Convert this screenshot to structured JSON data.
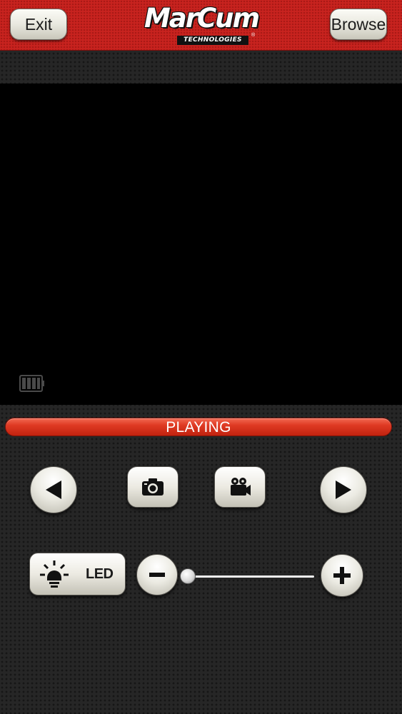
{
  "header": {
    "exit_label": "Exit",
    "browse_label": "Browse",
    "logo_text": "MarCum",
    "logo_subtext": "TECHNOLOGIES"
  },
  "status": {
    "text": "PLAYING"
  },
  "controls": {
    "prev_icon": "triangle-left-icon",
    "camera_icon": "camera-icon",
    "record_icon": "video-camera-icon",
    "next_icon": "triangle-right-icon",
    "led_label": "LED",
    "led_icon": "light-bulb-icon",
    "minus_icon": "minus-icon",
    "plus_icon": "plus-icon",
    "led_brightness_fraction": 0.0
  },
  "video": {
    "battery_icon": "battery-icon"
  },
  "colors": {
    "header_red": "#c8231f",
    "status_red": "#df3a23",
    "button_face": "#ecebe3",
    "background": "#262626"
  }
}
